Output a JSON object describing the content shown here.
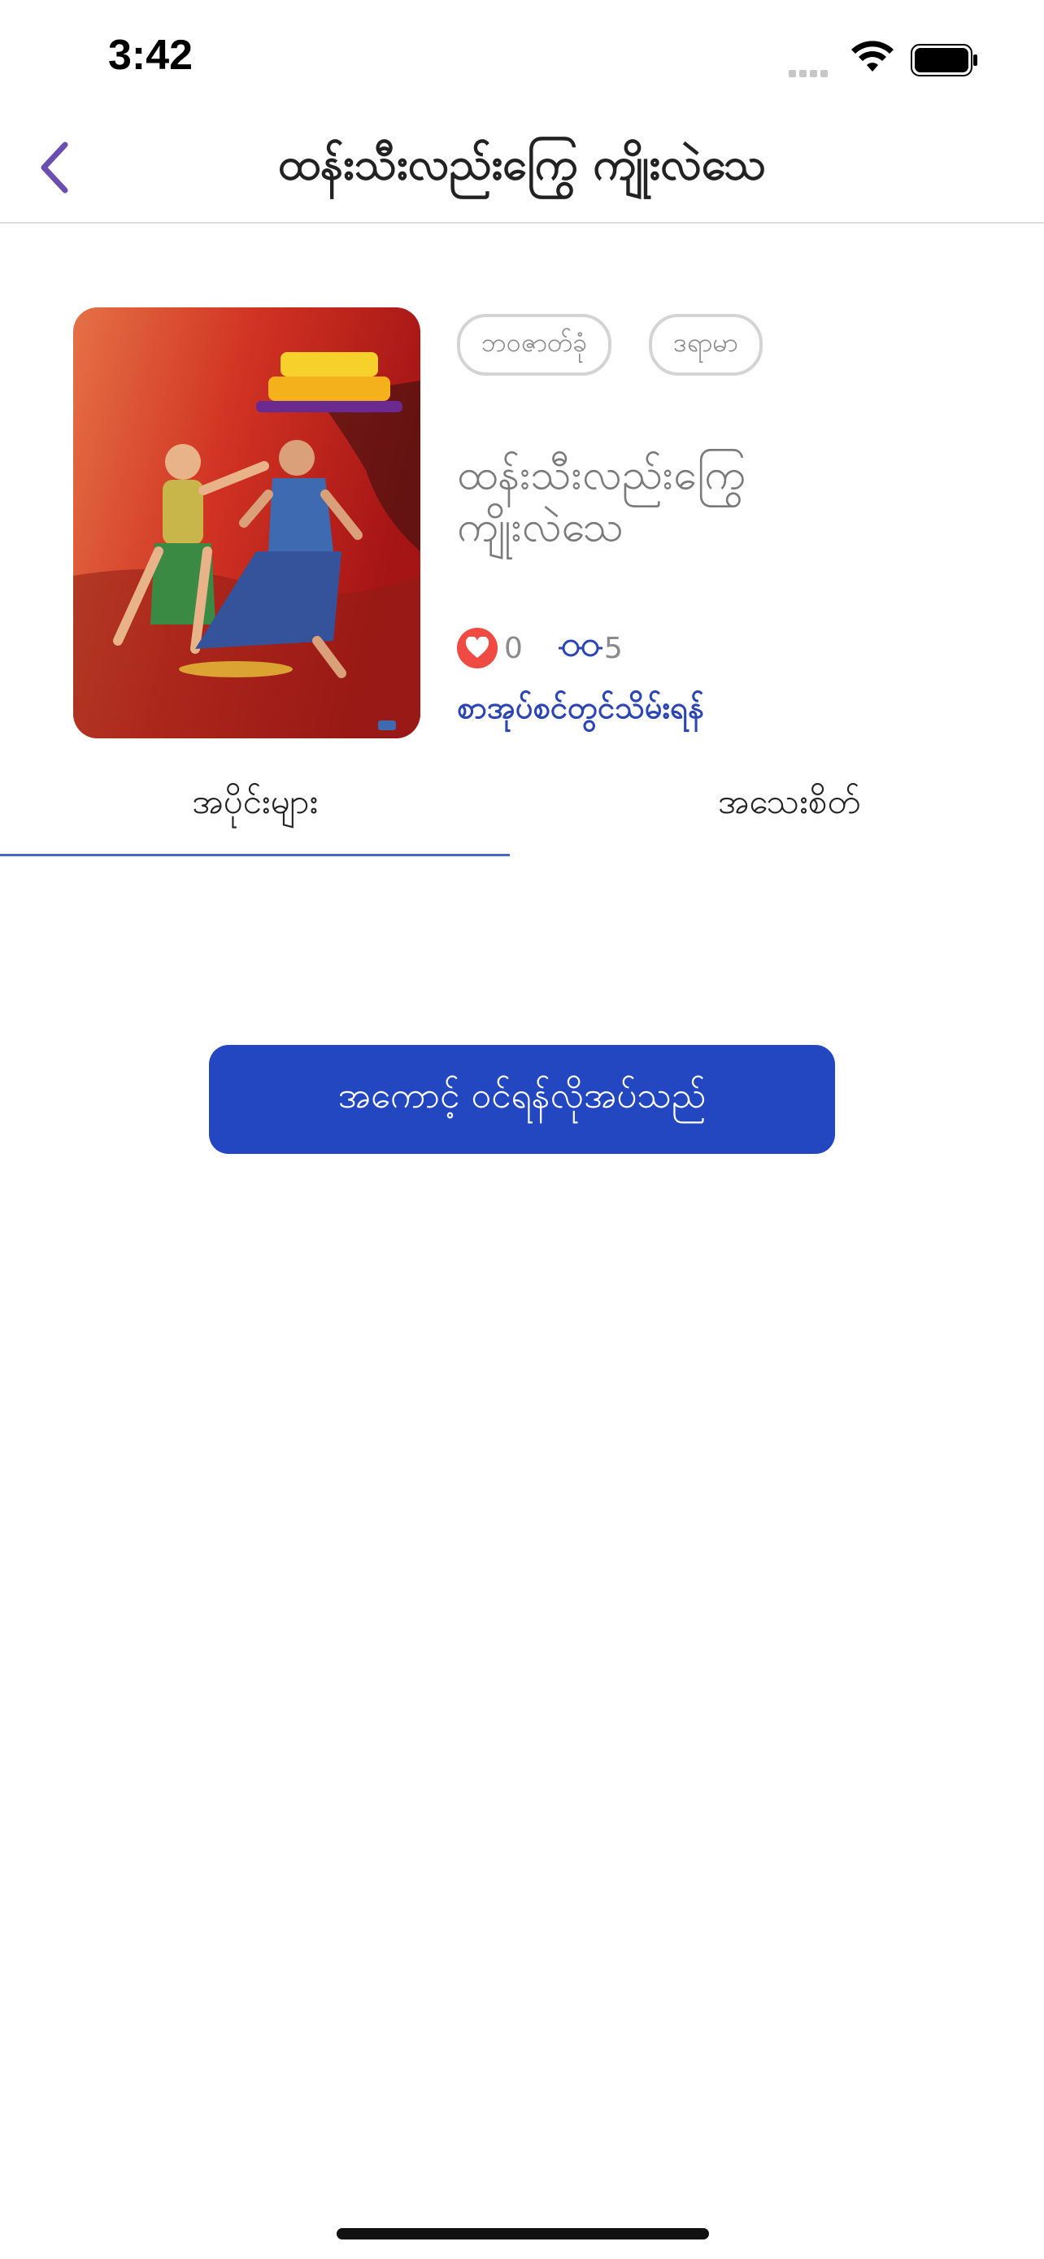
{
  "status_bar": {
    "time": "3:42"
  },
  "nav": {
    "title": "ထန်းသီးလည်းကြွေ ကျိုးလဲသေ",
    "back_icon": "chevron-left-icon"
  },
  "book": {
    "tags": [
      "ဘဝဇာတ်ခုံ",
      "ဒရာမာ"
    ],
    "title": "ထန်းသီးလည်းကြွေ ကျိုးလဲသေ",
    "likes": "0",
    "views": "5",
    "author_link": "စာအုပ်စင်တွင်သိမ်းရန်",
    "cover_colors": {
      "top": "#c8201e",
      "left": "#e57145"
    }
  },
  "tabs": [
    {
      "label": "အပိုင်းများ",
      "selected": true
    },
    {
      "label": "အသေးစိတ်",
      "selected": false
    }
  ],
  "read_button": {
    "label": "အကောင့် ဝင်ရန်လိုအပ်သည်"
  },
  "colors": {
    "accent": "#2346c1",
    "back_icon": "#6a4fb0",
    "heart": "#f04b42"
  }
}
